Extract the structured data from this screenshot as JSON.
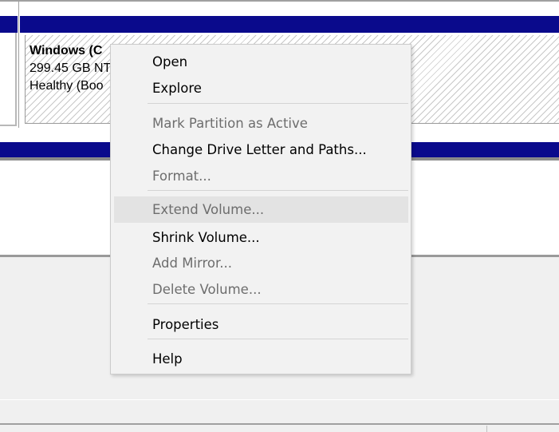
{
  "partition": {
    "name": "Windows  (C",
    "size_line": "299.45 GB NT",
    "status_line": "Healthy (Boo"
  },
  "context_menu": {
    "items": [
      {
        "label": "Open",
        "enabled": true
      },
      {
        "label": "Explore",
        "enabled": true
      },
      {
        "label": "Mark Partition as Active",
        "enabled": false
      },
      {
        "label": "Change Drive Letter and Paths...",
        "enabled": true
      },
      {
        "label": "Format...",
        "enabled": false
      },
      {
        "label": "Extend Volume...",
        "enabled": false,
        "hovered": true
      },
      {
        "label": "Shrink Volume...",
        "enabled": true
      },
      {
        "label": "Add Mirror...",
        "enabled": false
      },
      {
        "label": "Delete Volume...",
        "enabled": false
      },
      {
        "label": "Properties",
        "enabled": true
      },
      {
        "label": "Help",
        "enabled": true
      }
    ]
  },
  "colors": {
    "disk_header": "#0a0a8c",
    "menu_background": "#f2f2f2",
    "menu_text": "#000000",
    "menu_text_disabled": "#6d6d6d",
    "menu_highlight": "#e3e3e3"
  }
}
